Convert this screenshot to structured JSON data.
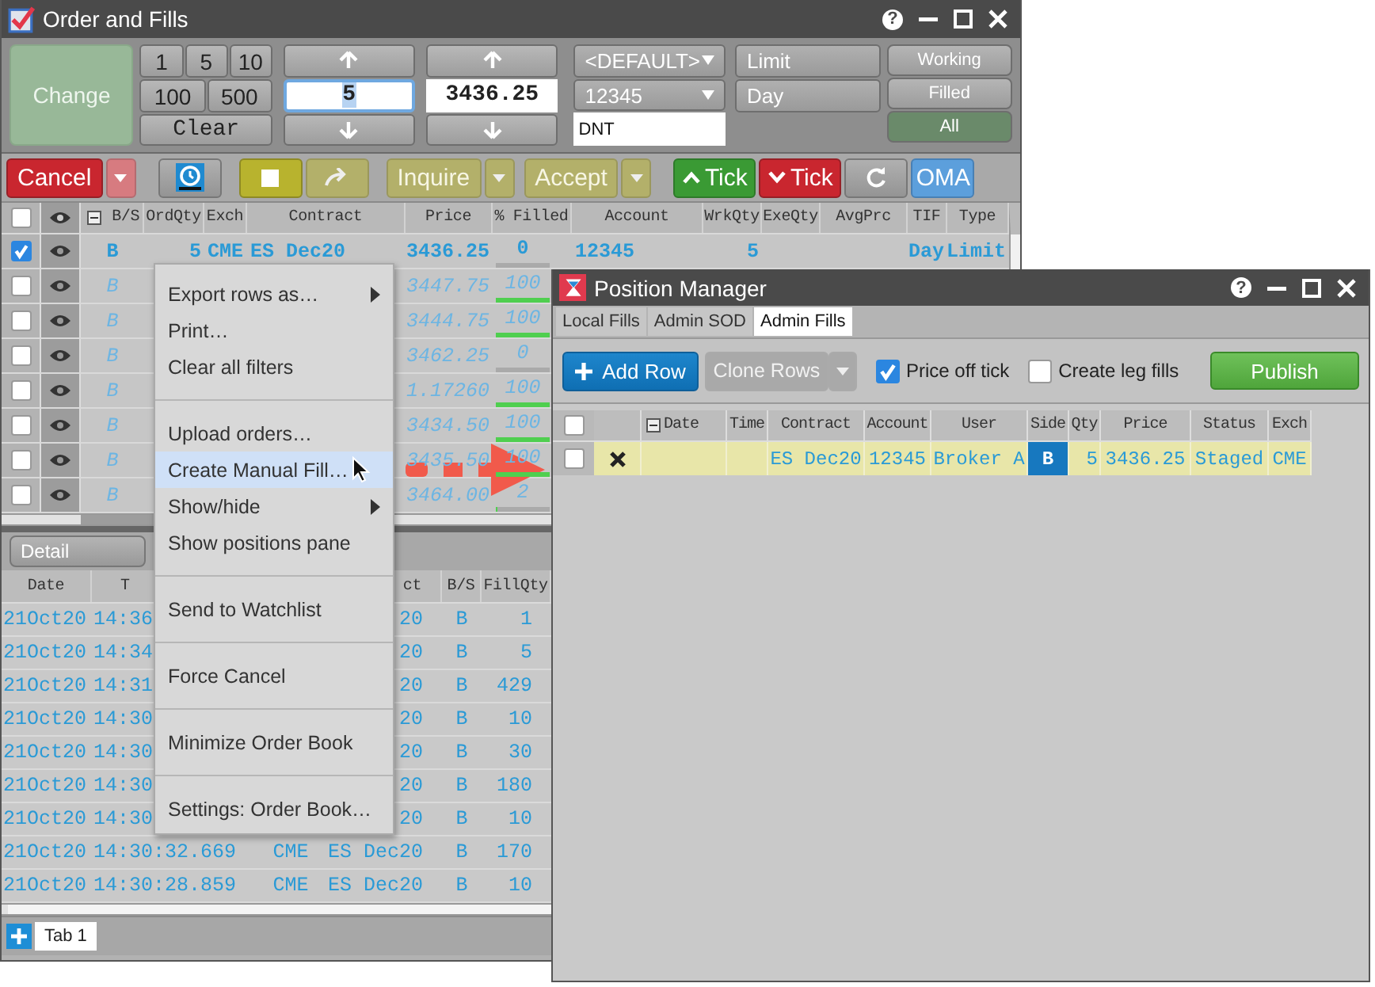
{
  "order_window": {
    "title": "Order and Fills",
    "help": "?",
    "entry": {
      "change": {
        "label": "Change",
        "disabled": true
      },
      "qty_presets": [
        "1",
        "5",
        "10",
        "100",
        "500"
      ],
      "clear": "Clear",
      "quantity": "5",
      "price": "3436.25",
      "account_profile": "<DEFAULT>",
      "account": "12345",
      "text_field": "DNT",
      "order_type": "Limit",
      "tif": "Day",
      "filters": [
        {
          "label": "Working",
          "selected": false
        },
        {
          "label": "Filled",
          "selected": false
        },
        {
          "label": "All",
          "selected": true
        }
      ]
    },
    "toolbar": {
      "cancel": {
        "label": "Cancel"
      },
      "inquire": {
        "label": "Inquire",
        "disabled": true
      },
      "accept": {
        "label": "Accept",
        "disabled": true
      },
      "tick_up": {
        "label": "Tick"
      },
      "tick_down": {
        "label": "Tick"
      },
      "oma": {
        "label": "OMA"
      }
    },
    "orders": {
      "select_all": {
        "checked": false
      },
      "columns": [
        "B/S",
        "OrdQty",
        "Exch",
        "Contract",
        "Price",
        "% Filled",
        "Account",
        "WrkQty",
        "ExeQty",
        "AvgPrc",
        "TIF",
        "Type"
      ],
      "rows": [
        {
          "checked": true,
          "working": true,
          "side": "B",
          "qty": "5",
          "exch": "CME",
          "contract": "ES Dec20",
          "price": "3436.25",
          "filled": "0",
          "level": 0,
          "account": "12345",
          "wrk_qty": "5",
          "tif": "Day",
          "type": "Limit"
        },
        {
          "checked": false,
          "working": false,
          "side": "B",
          "price": "3447.75",
          "filled": "100",
          "level": 1
        },
        {
          "checked": false,
          "working": false,
          "side": "B",
          "price": "3444.75",
          "filled": "100",
          "level": 1
        },
        {
          "checked": false,
          "working": false,
          "side": "B",
          "price": "3462.25",
          "filled": "0",
          "level": 0
        },
        {
          "checked": false,
          "working": false,
          "side": "B",
          "price": "1.17260",
          "filled": "100",
          "level": 1
        },
        {
          "checked": false,
          "working": false,
          "side": "B",
          "price": "3434.50",
          "filled": "100",
          "level": 1
        },
        {
          "checked": false,
          "working": false,
          "side": "B",
          "price": "3435.50",
          "filled": "100",
          "level": 1
        },
        {
          "checked": false,
          "working": false,
          "side": "B",
          "price": "3464.00",
          "filled": "2",
          "level": 0.02
        }
      ]
    },
    "fills": {
      "view": "Detail",
      "columns": [
        "Date",
        "T",
        "ct",
        "B/S",
        "FillQty"
      ],
      "rows": [
        {
          "date": "21Oct20",
          "time": "14:36",
          "contract": "20",
          "side": "B",
          "qty": "1"
        },
        {
          "date": "21Oct20",
          "time": "14:34",
          "contract": "20",
          "side": "B",
          "qty": "5"
        },
        {
          "date": "21Oct20",
          "time": "14:31",
          "contract": "20",
          "side": "B",
          "qty": "429"
        },
        {
          "date": "21Oct20",
          "time": "14:30",
          "contract": "20",
          "side": "B",
          "qty": "10"
        },
        {
          "date": "21Oct20",
          "time": "14:30",
          "contract": "20",
          "side": "B",
          "qty": "30"
        },
        {
          "date": "21Oct20",
          "time": "14:30",
          "contract": "20",
          "side": "B",
          "qty": "180"
        },
        {
          "date": "21Oct20",
          "time": "14:30",
          "contract": "20",
          "side": "B",
          "qty": "10"
        },
        {
          "date": "21Oct20",
          "time": "14:30:32.669",
          "exch": "CME",
          "contract": "ES Dec20",
          "side": "B",
          "qty": "170"
        },
        {
          "date": "21Oct20",
          "time": "14:30:28.859",
          "exch": "CME",
          "contract": "ES Dec20",
          "side": "B",
          "qty": "10"
        }
      ]
    },
    "tabs": [
      {
        "label": "Tab 1",
        "selected": true
      }
    ]
  },
  "context_menu": {
    "groups": [
      [
        {
          "label": "Export rows as…",
          "submenu": true,
          "selected": false
        },
        {
          "label": "Print…",
          "submenu": false,
          "selected": false
        },
        {
          "label": "Clear all filters",
          "submenu": false,
          "selected": false
        }
      ],
      [
        {
          "label": "Upload orders…",
          "submenu": false,
          "selected": false
        },
        {
          "label": "Create Manual Fill…",
          "submenu": false,
          "selected": true
        },
        {
          "label": "Show/hide",
          "submenu": true,
          "selected": false
        },
        {
          "label": "Show positions pane",
          "submenu": false,
          "selected": false
        }
      ],
      [
        {
          "label": "Send to Watchlist",
          "submenu": false,
          "selected": false
        }
      ],
      [
        {
          "label": "Force Cancel",
          "submenu": false,
          "selected": false
        }
      ],
      [
        {
          "label": "Minimize Order Book",
          "submenu": false,
          "selected": false
        }
      ],
      [
        {
          "label": "Settings: Order Book…",
          "submenu": false,
          "selected": false
        }
      ]
    ]
  },
  "position_manager": {
    "title": "Position Manager",
    "help": "?",
    "tabs": [
      {
        "label": "Local Fills",
        "selected": false
      },
      {
        "label": "Admin SOD",
        "selected": false
      },
      {
        "label": "Admin Fills",
        "selected": true
      }
    ],
    "add_row": "Add Row",
    "clone_rows": {
      "label": "Clone Rows",
      "disabled": true
    },
    "options": [
      {
        "label": "Price off tick",
        "checked": true
      },
      {
        "label": "Create leg fills",
        "checked": false
      }
    ],
    "publish": "Publish",
    "select_all": {
      "checked": false
    },
    "columns": [
      "Date",
      "Time",
      "Contract",
      "Account",
      "User",
      "Side",
      "Qty",
      "Price",
      "Status",
      "Exch"
    ],
    "rows": [
      {
        "checked": false,
        "contract": "ES Dec20",
        "account": "12345",
        "user": "Broker A",
        "side": "B",
        "qty": "5",
        "price": "3436.25",
        "status": "Staged",
        "exch": "CME"
      }
    ]
  }
}
